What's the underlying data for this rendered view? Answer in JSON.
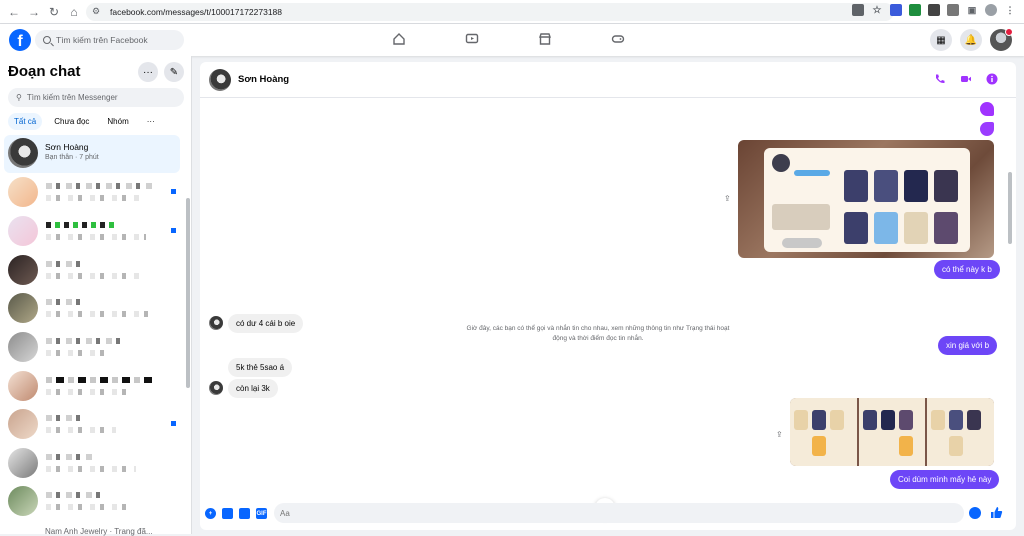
{
  "browser": {
    "url": "facebook.com/messages/t/100017172273188"
  },
  "header": {
    "search_placeholder": "Tìm kiếm trên Facebook"
  },
  "sidebar": {
    "title": "Đoạn chat",
    "search_placeholder": "Tìm kiếm trên Messenger",
    "tabs": [
      "Tất cả",
      "Chưa đọc",
      "Nhóm",
      "···"
    ],
    "active_conversation": {
      "name": "Sơn Hoàng",
      "subtitle": "Bạn thân · 7 phút"
    },
    "bottom_partial": "Nam Anh Jewelry · Trang đã..."
  },
  "chat": {
    "contact_name": "Sơn Hoàng",
    "notice": "Giờ đây, các bạn có thể gọi và nhắn tin cho nhau, xem những thông tin như Trạng thái hoạt động và thời điểm đọc tin nhắn.",
    "messages": {
      "out1": "có thể này k b",
      "in1": "có dư 4 cái b oie",
      "out2": "xin giá với b",
      "in2": "5k thẻ 5sao á",
      "in3": "còn lại 3k",
      "out3": "Coi dùm mình mấy hẻ này"
    },
    "composer_placeholder": "Aa"
  },
  "colors": {
    "fb_blue": "#0866ff",
    "messenger_purple": "#6d46f7",
    "call_icon": "#a033ff"
  }
}
